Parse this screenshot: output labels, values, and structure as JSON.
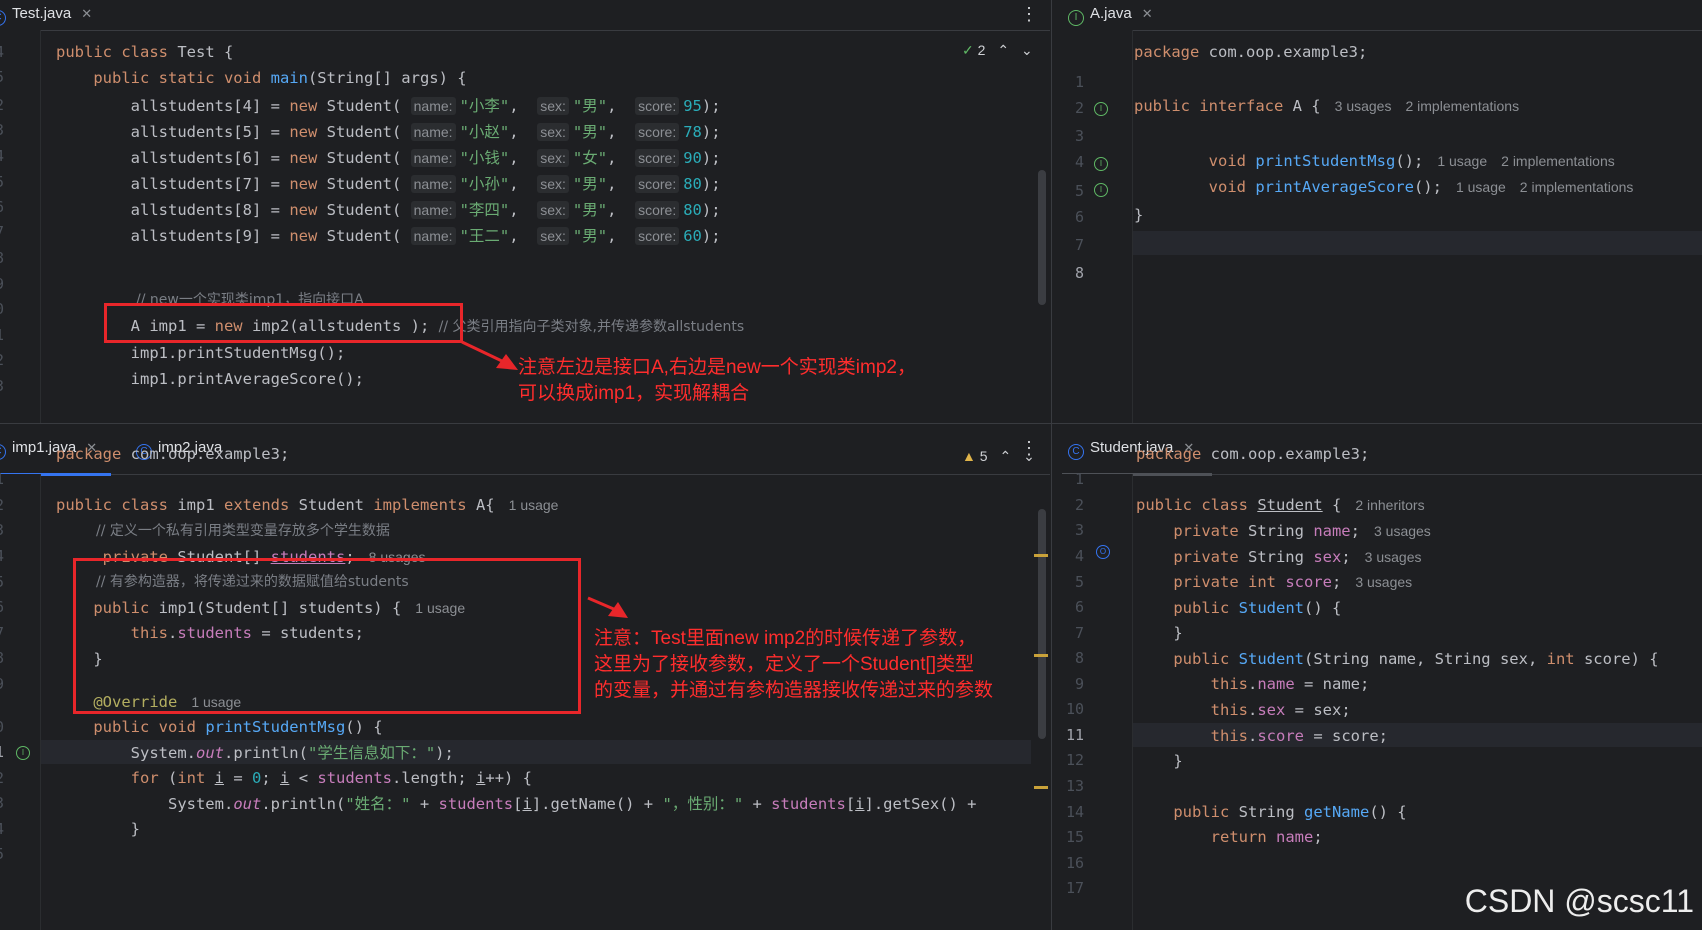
{
  "tabs": {
    "test": "Test.java",
    "a": "A.java",
    "imp1": "imp1.java",
    "imp2": "imp2.java",
    "student": "Student.java"
  },
  "inspections": {
    "test": "2",
    "imp1": "5"
  },
  "test_editor": {
    "line_numbers": [
      "4",
      "5",
      "2",
      "3",
      "4",
      "5",
      "6",
      "7",
      "8",
      "9",
      "0",
      "1",
      "2",
      "3"
    ],
    "hints": {
      "name": "name:",
      "sex": "sex:",
      "score": "score:"
    },
    "rows": [
      {
        "idx": "4",
        "name": "\"小李\"",
        "sex": "\"男\"",
        "score": "95"
      },
      {
        "idx": "5",
        "name": "\"小赵\"",
        "sex": "\"男\"",
        "score": "78"
      },
      {
        "idx": "6",
        "name": "\"小钱\"",
        "sex": "\"女\"",
        "score": "90"
      },
      {
        "idx": "7",
        "name": "\"小孙\"",
        "sex": "\"男\"",
        "score": "80"
      },
      {
        "idx": "8",
        "name": "\"李四\"",
        "sex": "\"男\"",
        "score": "80"
      },
      {
        "idx": "9",
        "name": "\"王二\"",
        "sex": "\"男\"",
        "score": "60"
      }
    ],
    "comment1": "// new一个实现类imp1，指向接口A",
    "comment2": "// 父类引用指向子类对象,并传递参数allstudents"
  },
  "a_editor": {
    "line_numbers": [
      "1",
      "2",
      "3",
      "4",
      "5",
      "6",
      "7",
      "8"
    ],
    "package": "com.oop.example3;",
    "usages_interface": "3 usages",
    "impl_interface": "2 implementations",
    "usage_method": "1 usage",
    "impl_method": "2 implementations"
  },
  "imp1_editor": {
    "line_numbers": [
      "1",
      "2",
      "3",
      "4",
      "5",
      "6",
      "7",
      "8",
      "9",
      "0",
      "1",
      "2",
      "3",
      "4",
      "5"
    ],
    "package": "com.oop.example3;",
    "usage_class": "1 usage",
    "comment1": "// 定义一个私有引用类型变量存放多个学生数据",
    "usages_students": "8 usages",
    "comment2": "// 有参构造器，将传递过来的数据赋值给students",
    "usage_ctor": "1 usage",
    "usage_override": "1 usage",
    "str_header": "\"学生信息如下：\"",
    "str_name": "\"姓名：\"",
    "str_sex": "\"，性别：\""
  },
  "student_editor": {
    "line_numbers": [
      "1",
      "2",
      "3",
      "4",
      "5",
      "6",
      "7",
      "8",
      "9",
      "10",
      "11",
      "12",
      "13",
      "14",
      "15",
      "16",
      "17"
    ],
    "package": "com.oop.example3;",
    "inheritors": "2 inheritors",
    "usages": "3 usages"
  },
  "notes": {
    "top_line1": "注意左边是接口A,右边是new一个实现类imp2，",
    "top_line2": "可以换成imp1，实现解耦合",
    "bottom_line1": "注意：Test里面new imp2的时候传递了参数，",
    "bottom_line2": "这里为了接收参数，定义了一个Student[]类型",
    "bottom_line3": "的变量，并通过有参构造器接收传递过来的参数"
  },
  "watermark": "CSDN @scsc11",
  "colors": {
    "red_annotation": "#e8262a",
    "accent": "#3574f0",
    "background": "#1e1f22"
  }
}
